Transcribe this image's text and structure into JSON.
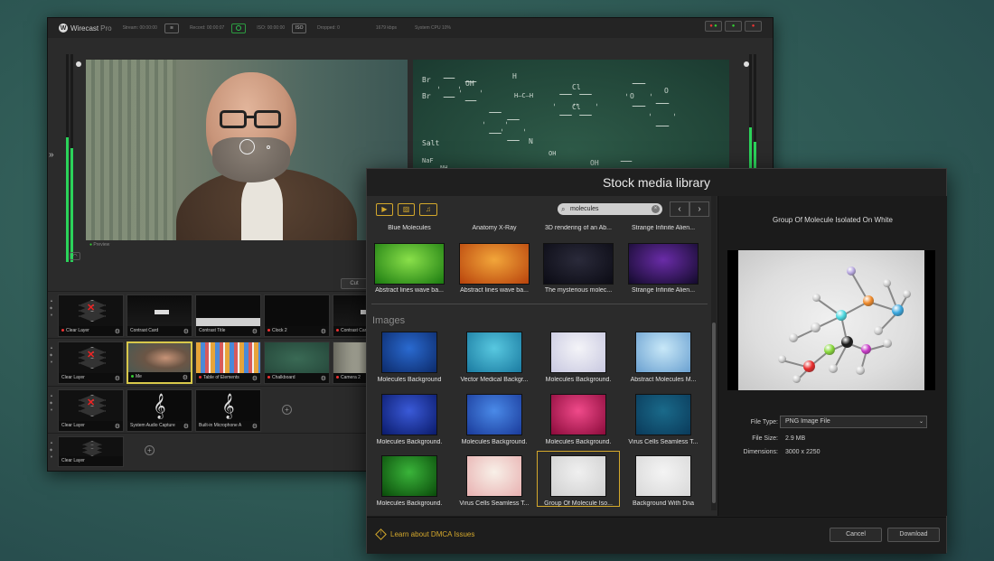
{
  "wirecast": {
    "app_name": "Wirecast",
    "edition": "Pro",
    "stats": {
      "stream": "Stream: 00:00:00",
      "record": "Record: 00:00:07",
      "iso": "ISO: 00:00:00",
      "dropped": "Dropped: 0",
      "kbps": "1679 kbps",
      "cpu": "System CPU 10%"
    },
    "iso_button": "ISO",
    "preview_label": "Preview",
    "cut_button": "Cut",
    "layers": [
      {
        "shots": [
          {
            "label": "Clear Layer",
            "kind": "clear"
          },
          {
            "label": "Contrast Card",
            "kind": "card"
          },
          {
            "label": "Contrast Title",
            "kind": "title"
          },
          {
            "label": "Clock 2",
            "kind": "clock"
          },
          {
            "label": "Contrast Card",
            "kind": "card"
          }
        ]
      },
      {
        "shots": [
          {
            "label": "Clear Layer",
            "kind": "clear"
          },
          {
            "label": "Me",
            "kind": "person"
          },
          {
            "label": "Table of Elements",
            "kind": "table"
          },
          {
            "label": "Chalkboard",
            "kind": "chalk"
          },
          {
            "label": "Camera 2",
            "kind": "room"
          }
        ]
      },
      {
        "shots": [
          {
            "label": "Clear Layer",
            "kind": "clear"
          },
          {
            "label": "System Audio Capture",
            "kind": "audio"
          },
          {
            "label": "Built-in Microphone A",
            "kind": "audio"
          }
        ]
      },
      {
        "shots": [
          {
            "label": "Clear Layer",
            "kind": "clear"
          }
        ]
      }
    ],
    "chalk_texts": [
      "Br",
      "Br",
      "OH",
      "H",
      "H—C—H",
      "Salt",
      "NaF",
      "NH",
      "OH",
      "Cl",
      "Cl",
      "O",
      "O",
      "N",
      "OH"
    ]
  },
  "stock_library": {
    "title": "Stock media library",
    "search_value": "molecules",
    "nav_prev": "‹",
    "nav_next": "›",
    "type_icons": [
      "video-icon",
      "image-icon",
      "audio-icon"
    ],
    "video_titles_top": [
      "Blue Molecules",
      "Anatomy X-Ray",
      "3D rendering of an Ab...",
      "Strange Infinite Alien..."
    ],
    "videos": [
      {
        "label": "Abstract lines wave ba...",
        "colors": [
          "#8ae04a",
          "#1a7a10"
        ]
      },
      {
        "label": "Abstract lines wave ba...",
        "colors": [
          "#f2a63a",
          "#b8420c"
        ]
      },
      {
        "label": "The mysterious molec...",
        "colors": [
          "#2a2a3a",
          "#0b0b14"
        ]
      },
      {
        "label": "Strange Infinite Alien...",
        "colors": [
          "#6a2ca8",
          "#120a2a"
        ]
      }
    ],
    "images_heading": "Images",
    "images": [
      {
        "label": "Molecules Background",
        "colors": [
          "#2a6ad0",
          "#0c2a6a"
        ]
      },
      {
        "label": "Vector Medical Backgr...",
        "colors": [
          "#58c8e0",
          "#1a7aa0"
        ]
      },
      {
        "label": "Molecules Background.",
        "colors": [
          "#f4f4f8",
          "#c8c8e0"
        ]
      },
      {
        "label": "Abstract Molecules M...",
        "colors": [
          "#c8e8f8",
          "#6aa0d0"
        ]
      },
      {
        "label": "Molecules Background.",
        "colors": [
          "#3a5ad8",
          "#0a1a6a"
        ]
      },
      {
        "label": "Molecules Background.",
        "colors": [
          "#4a8ae8",
          "#1a3a9a"
        ]
      },
      {
        "label": "Molecules Background.",
        "colors": [
          "#f04a8a",
          "#8a0a3a"
        ]
      },
      {
        "label": "Virus Cells Seamless T...",
        "colors": [
          "#1a6a8a",
          "#0a3a5a"
        ]
      },
      {
        "label": "Molecules Background.",
        "colors": [
          "#3ab43a",
          "#0a4a0a"
        ]
      },
      {
        "label": "Virus Cells Seamless T...",
        "colors": [
          "#f8f0e8",
          "#e8b0b0"
        ]
      },
      {
        "label": "Group Of Molecule Iso...",
        "colors": [
          "#f0f0f0",
          "#cfcfcf"
        ],
        "selected": true
      },
      {
        "label": "Background With Dna",
        "colors": [
          "#f4f4f4",
          "#d8d8d8"
        ]
      }
    ],
    "preview": {
      "title": "Group Of Molecule Isolated On White",
      "file_type_label": "File Type:",
      "file_type_value": "PNG Image File",
      "file_size_label": "File Size:",
      "file_size_value": "2.9 MB",
      "dimensions_label": "Dimensions:",
      "dimensions_value": "3000 x 2250"
    },
    "footer": {
      "dmca_link": "Learn about DMCA Issues",
      "cancel": "Cancel",
      "download": "Download"
    }
  }
}
